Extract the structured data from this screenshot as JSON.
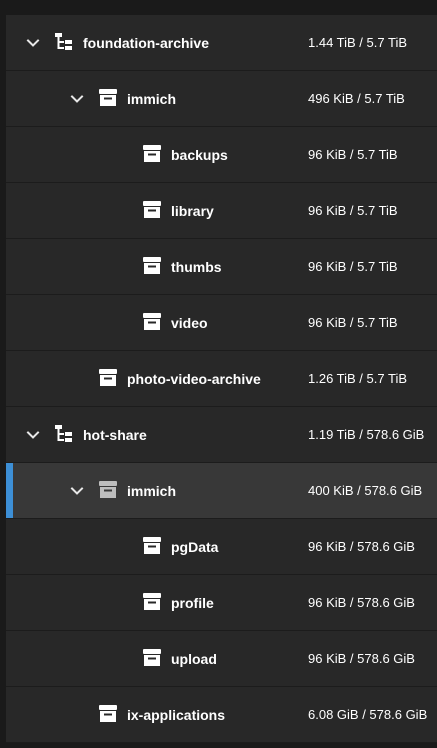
{
  "colors": {
    "row_background": "#282828",
    "selected_row_background": "#383838",
    "selection_accent": "#3d8fd6",
    "text": "#ffffff"
  },
  "datasets": [
    {
      "name": "foundation-archive",
      "usage": "1.44 TiB / 5.7 TiB",
      "level": 0,
      "icon": "pool-tree-icon",
      "expandable": true,
      "selected": false
    },
    {
      "name": "immich",
      "usage": "496 KiB / 5.7 TiB",
      "level": 1,
      "icon": "dataset-icon",
      "expandable": true,
      "selected": false
    },
    {
      "name": "backups",
      "usage": "96 KiB / 5.7 TiB",
      "level": 2,
      "icon": "dataset-icon",
      "expandable": false,
      "selected": false
    },
    {
      "name": "library",
      "usage": "96 KiB / 5.7 TiB",
      "level": 2,
      "icon": "dataset-icon",
      "expandable": false,
      "selected": false
    },
    {
      "name": "thumbs",
      "usage": "96 KiB / 5.7 TiB",
      "level": 2,
      "icon": "dataset-icon",
      "expandable": false,
      "selected": false
    },
    {
      "name": "video",
      "usage": "96 KiB / 5.7 TiB",
      "level": 2,
      "icon": "dataset-icon",
      "expandable": false,
      "selected": false
    },
    {
      "name": "photo-video-archive",
      "usage": "1.26 TiB / 5.7 TiB",
      "level": 1,
      "icon": "dataset-icon",
      "expandable": false,
      "selected": false
    },
    {
      "name": "hot-share",
      "usage": "1.19 TiB / 578.6 GiB",
      "level": 0,
      "icon": "pool-tree-icon",
      "expandable": true,
      "selected": false
    },
    {
      "name": "immich",
      "usage": "400 KiB / 578.6 GiB",
      "level": 1,
      "icon": "dataset-icon",
      "expandable": true,
      "selected": true
    },
    {
      "name": "pgData",
      "usage": "96 KiB / 578.6 GiB",
      "level": 2,
      "icon": "dataset-icon",
      "expandable": false,
      "selected": false
    },
    {
      "name": "profile",
      "usage": "96 KiB / 578.6 GiB",
      "level": 2,
      "icon": "dataset-icon",
      "expandable": false,
      "selected": false
    },
    {
      "name": "upload",
      "usage": "96 KiB / 578.6 GiB",
      "level": 2,
      "icon": "dataset-icon",
      "expandable": false,
      "selected": false
    },
    {
      "name": "ix-applications",
      "usage": "6.08 GiB / 578.6 GiB",
      "level": 1,
      "icon": "dataset-icon",
      "expandable": false,
      "selected": false
    }
  ]
}
